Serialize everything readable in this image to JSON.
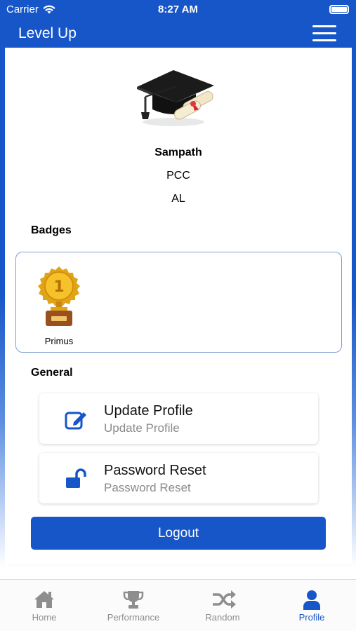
{
  "status_bar": {
    "carrier": "Carrier",
    "time": "8:27 AM"
  },
  "header": {
    "title": "Level Up",
    "menu_icon": "hamburger-menu-icon"
  },
  "profile": {
    "avatar_icon": "graduation-cap-icon",
    "name": "Sampath",
    "line1": "PCC",
    "line2": "AL"
  },
  "badges": {
    "title": "Badges",
    "items": [
      {
        "label": "Primus",
        "icon": "trophy-badge-icon"
      }
    ]
  },
  "general": {
    "title": "General",
    "items": [
      {
        "title": "Update Profile",
        "subtitle": "Update Profile",
        "icon": "edit-icon"
      },
      {
        "title": "Password Reset",
        "subtitle": "Password Reset",
        "icon": "unlock-icon"
      }
    ]
  },
  "logout_label": "Logout",
  "tabs": [
    {
      "label": "Home",
      "icon": "home-icon",
      "active": false
    },
    {
      "label": "Performance",
      "icon": "trophy-icon",
      "active": false
    },
    {
      "label": "Random",
      "icon": "shuffle-icon",
      "active": false
    },
    {
      "label": "Profile",
      "icon": "user-icon",
      "active": true
    }
  ],
  "colors": {
    "primary": "#1756c9",
    "tab_inactive": "#8e8e8e",
    "badge_border": "#7d9fd6"
  }
}
